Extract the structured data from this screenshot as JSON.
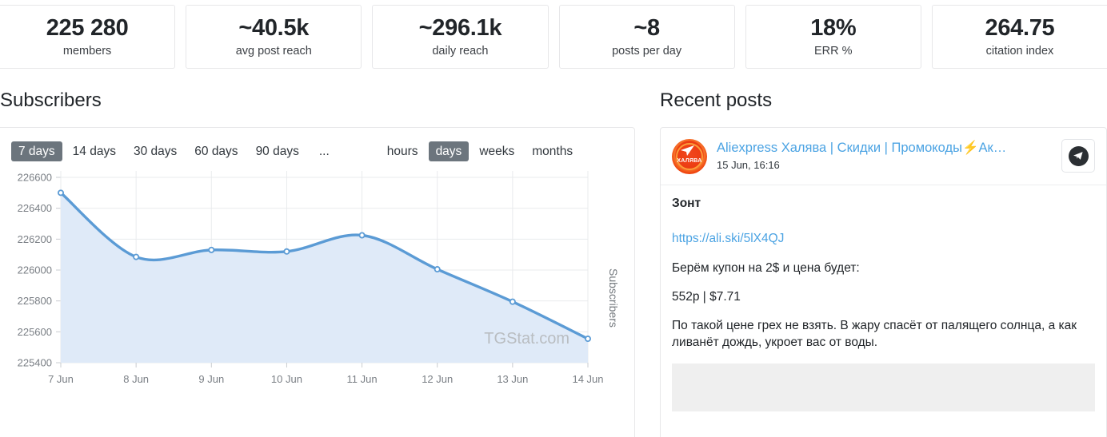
{
  "stats": [
    {
      "value": "225 280",
      "label": "members"
    },
    {
      "value": "~40.5k",
      "label": "avg post reach"
    },
    {
      "value": "~296.1k",
      "label": "daily reach"
    },
    {
      "value": "~8",
      "label": "posts per day"
    },
    {
      "value": "18%",
      "label": "ERR %"
    },
    {
      "value": "264.75",
      "label": "citation index"
    }
  ],
  "left": {
    "title": "Subscribers",
    "ranges": [
      {
        "label": "7 days",
        "active": true
      },
      {
        "label": "14 days",
        "active": false
      },
      {
        "label": "30 days",
        "active": false
      },
      {
        "label": "60 days",
        "active": false
      },
      {
        "label": "90 days",
        "active": false
      },
      {
        "label": "...",
        "active": false
      }
    ],
    "granularity": [
      {
        "label": "hours",
        "active": false
      },
      {
        "label": "days",
        "active": true
      },
      {
        "label": "weeks",
        "active": false
      },
      {
        "label": "months",
        "active": false
      }
    ],
    "watermark": "TGStat.com"
  },
  "right": {
    "title": "Recent posts",
    "post": {
      "channel": "Aliexpress Халява | Скидки | Промокоды",
      "channel_bolt": "⚡",
      "channel_tail": "Ак…",
      "date": "15 Jun, 16:16",
      "avatar_text": "ХАЛЯВА",
      "share_icon": "telegram-icon",
      "title": "Зонт",
      "link": "https://ali.ski/5lX4QJ",
      "line_coupon": "Берём купон на 2$ и цена будет:",
      "line_price": "552р | $7.71",
      "line_desc": "По такой цене грех не взять. В жару спасёт от палящего солнца, а как ливанёт дождь, укроет вас от воды."
    }
  },
  "colors": {
    "accent_line": "#5b9bd5",
    "accent_fill": "#dfeaf8",
    "chip_active": "#6c757d",
    "link": "#4ba3e3",
    "avatar": "#ec3c12"
  },
  "chart_data": {
    "type": "area",
    "title": "Subscribers",
    "xlabel": "",
    "ylabel": "Subscribers",
    "categories": [
      "7 Jun",
      "8 Jun",
      "9 Jun",
      "10 Jun",
      "11 Jun",
      "12 Jun",
      "13 Jun",
      "14 Jun"
    ],
    "values": [
      226500,
      226085,
      226130,
      226120,
      226225,
      226005,
      225795,
      225555
    ],
    "ylim": [
      225400,
      226600
    ],
    "yticks": [
      225400,
      225600,
      225800,
      226000,
      226200,
      226400,
      226600
    ],
    "grid": true,
    "legend": "none",
    "series": [
      {
        "name": "Subscribers",
        "values": [
          226500,
          226085,
          226130,
          226120,
          226225,
          226005,
          225795,
          225555
        ]
      }
    ]
  }
}
